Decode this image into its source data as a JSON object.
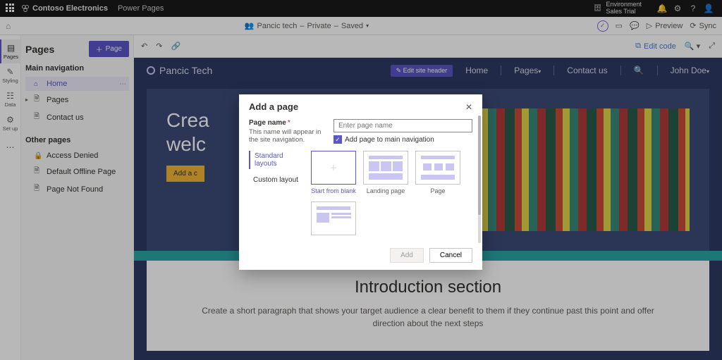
{
  "topbar1": {
    "brand": "Contoso Electronics",
    "app": "Power Pages",
    "env_label": "Environment",
    "env_value": "Sales Trial"
  },
  "topbar2": {
    "site_name": "Pancic tech",
    "visibility": "Private",
    "status": "Saved",
    "preview": "Preview",
    "sync": "Sync"
  },
  "rail": {
    "items": [
      {
        "label": "Pages"
      },
      {
        "label": "Styling"
      },
      {
        "label": "Data"
      },
      {
        "label": "Set up"
      }
    ]
  },
  "panel": {
    "title": "Pages",
    "add_btn": "Page",
    "section_main": "Main navigation",
    "section_other": "Other pages",
    "main_items": [
      {
        "label": "Home"
      },
      {
        "label": "Pages"
      },
      {
        "label": "Contact us"
      }
    ],
    "other_items": [
      {
        "label": "Access Denied"
      },
      {
        "label": "Default Offline Page"
      },
      {
        "label": "Page Not Found"
      }
    ]
  },
  "canvasbar": {
    "edit_code": "Edit code"
  },
  "site": {
    "title": "Pancic Tech",
    "edit_header": "Edit site header",
    "nav": {
      "home": "Home",
      "pages": "Pages",
      "contact": "Contact us",
      "user": "John Doe"
    },
    "hero_line1": "Crea",
    "hero_line2": "welc",
    "hero_cta": "Add a c"
  },
  "intro": {
    "heading": "Introduction section",
    "body": "Create a short paragraph that shows your target audience a clear benefit to them if they continue past this point and offer direction about the next steps"
  },
  "modal": {
    "title": "Add a page",
    "pagename_label": "Page name",
    "pagename_hint": "This name will appear in the site navigation.",
    "pagename_placeholder": "Enter page name",
    "add_to_nav": "Add page to main navigation",
    "layout_std": "Standard layouts",
    "layout_custom": "Custom layout",
    "tile_blank": "Start from blank",
    "tile_landing": "Landing page",
    "tile_page": "Page",
    "btn_add": "Add",
    "btn_cancel": "Cancel"
  }
}
